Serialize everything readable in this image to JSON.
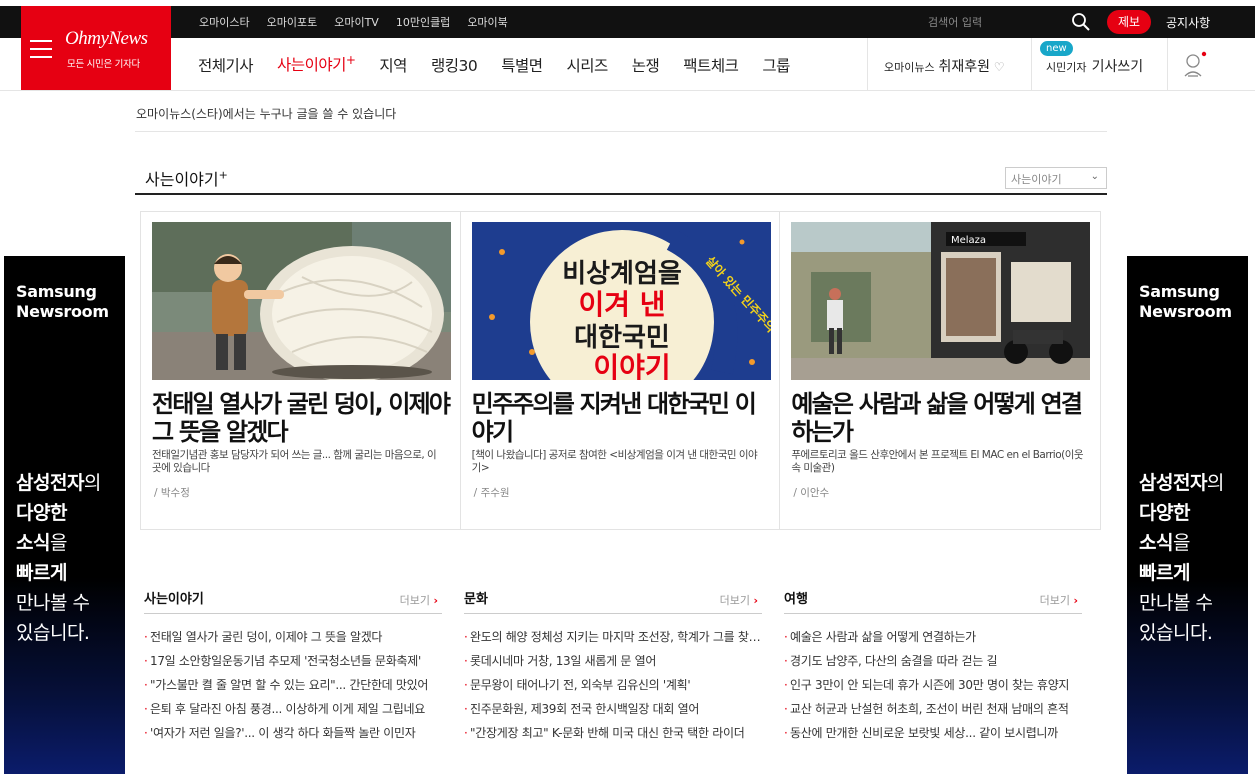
{
  "topbar": {
    "links": [
      "오마이스타",
      "오마이포토",
      "오마이TV",
      "10만인클럽",
      "오마이북"
    ],
    "search_placeholder": "검색어 입력",
    "report_label": "제보",
    "notice_label": "공지사항"
  },
  "logo": {
    "brand": "OhmyNews",
    "tagline": "모든 시민은 기자다"
  },
  "nav": {
    "items": [
      "전체기사",
      "사는이야기",
      "지역",
      "랭킹30",
      "특별면",
      "시리즈",
      "논쟁",
      "팩트체크",
      "그룹"
    ],
    "active_suffix": "+",
    "sponsor_prefix": "오마이뉴스",
    "sponsor_label": "취재후원",
    "writer_prefix": "시민기자",
    "writer_label": "기사쓰기",
    "new_badge": "new"
  },
  "intro": "오마이뉴스(스타)에서는 누구나 글을 쓸 수 있습니다",
  "section": {
    "title": "사는이야기",
    "title_mark": "+",
    "select_value": "사는이야기"
  },
  "cards": [
    {
      "title": "전태일 열사가 굴린 덩이, 이제야 그 뜻을 알겠다",
      "desc": "전태일기념관 홍보 담당자가 되어 쓰는 글... 함께 굴리는 마음으로, 이곳에 있습니다",
      "author": "박수정"
    },
    {
      "title": "민주주의를 지켜낸 대한국민 이야기",
      "desc": "[책이 나왔습니다] 공저로 참여한 <비상계엄을 이겨 낸 대한국민 이야기>",
      "author": "주수원",
      "book_lines": [
        "비상계엄을",
        "이겨 낸",
        "대한국민",
        "이야기"
      ],
      "book_arc": "살아 있는 민주주의 교과서"
    },
    {
      "title": "예술은 사람과 삶을 어떻게 연결하는가",
      "desc": "푸에르토리코 올드 산후안에서 본 프로젝트 El MAC en el Barrio(이웃 속 미술관)",
      "author": "이안수",
      "shop_sign": "Melaza"
    }
  ],
  "lists": [
    {
      "title": "사는이야기",
      "more": "더보기",
      "items": [
        "전태일 열사가 굴린 덩이, 이제야 그 뜻을 알겠다",
        "17일 소안항일운동기념 추모제 '전국청소년들 문화축제'",
        "\"가스불만 켤 줄 알면 할 수 있는 요리\"... 간단한데 맛있어",
        "은퇴 후 달라진 아침 풍경... 이상하게 이게 제일 그립네요",
        "'여자가 저런 일을?'... 이 생각 하다 화들짝 놀란 이민자"
      ]
    },
    {
      "title": "문화",
      "more": "더보기",
      "items": [
        "완도의 해양 정체성 지키는 마지막 조선장, 학계가 그를 찾는 이유",
        "롯데시네마 거창, 13일 새롭게 문 열어",
        "문무왕이 태어나기 전, 외숙부 김유신의 '계획'",
        "진주문화원, 제39회 전국 한시백일장 대회 열어",
        "\"간장게장 최고\" K-문화 반해 미국 대신 한국 택한 라이더"
      ]
    },
    {
      "title": "여행",
      "more": "더보기",
      "items": [
        "예술은 사람과 삶을 어떻게 연결하는가",
        "경기도 남양주, 다산의 숨결을 따라 걷는 길",
        "인구 3만이 안 되는데 휴가 시즌에 30만 명이 찾는 휴양지",
        "교산 허균과 난설헌 허초희, 조선이 버린 천재 남매의 흔적",
        "동산에 만개한 신비로운 보랏빛 세상... 같이 보시렵니까"
      ]
    }
  ],
  "ad": {
    "brand_line1": "Samsung",
    "brand_line2": "Newsroom",
    "msg": [
      {
        "bold": "삼성전자",
        "rest": "의"
      },
      {
        "bold": "다양한",
        "rest": ""
      },
      {
        "bold": "소식",
        "rest": "을"
      },
      {
        "bold": "빠르게",
        "rest": ""
      },
      {
        "bold": "",
        "rest": "만나볼 수"
      },
      {
        "bold": "",
        "rest": "있습니다."
      }
    ]
  },
  "colors": {
    "brand": "#e60012",
    "new_badge": "#18a7c9"
  }
}
